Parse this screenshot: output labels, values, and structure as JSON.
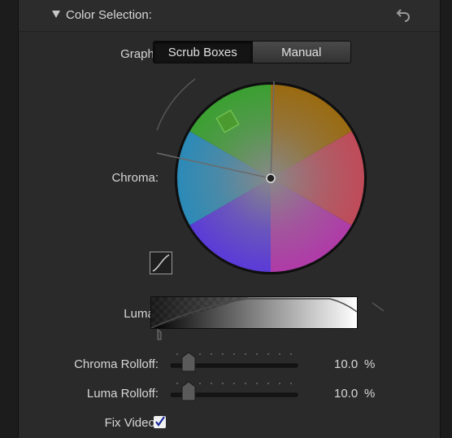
{
  "section": {
    "title": "Color Selection:",
    "collapse_icon": "disclosure-triangle-icon",
    "reset_icon": "reset-arrow-icon"
  },
  "graph": {
    "label": "Graph:",
    "options": [
      "Scrub Boxes",
      "Manual"
    ],
    "selected": "Scrub Boxes"
  },
  "chroma": {
    "label": "Chroma:",
    "curve_icon": "curve-editor-icon"
  },
  "luma": {
    "label": "Luma:"
  },
  "chroma_rolloff": {
    "label": "Chroma Rolloff:",
    "value": "10.0",
    "unit": "%",
    "fraction": 0.1
  },
  "luma_rolloff": {
    "label": "Luma Rolloff:",
    "value": "10.0",
    "unit": "%",
    "fraction": 0.1
  },
  "fix_video": {
    "label": "Fix Video:",
    "checked": true
  }
}
